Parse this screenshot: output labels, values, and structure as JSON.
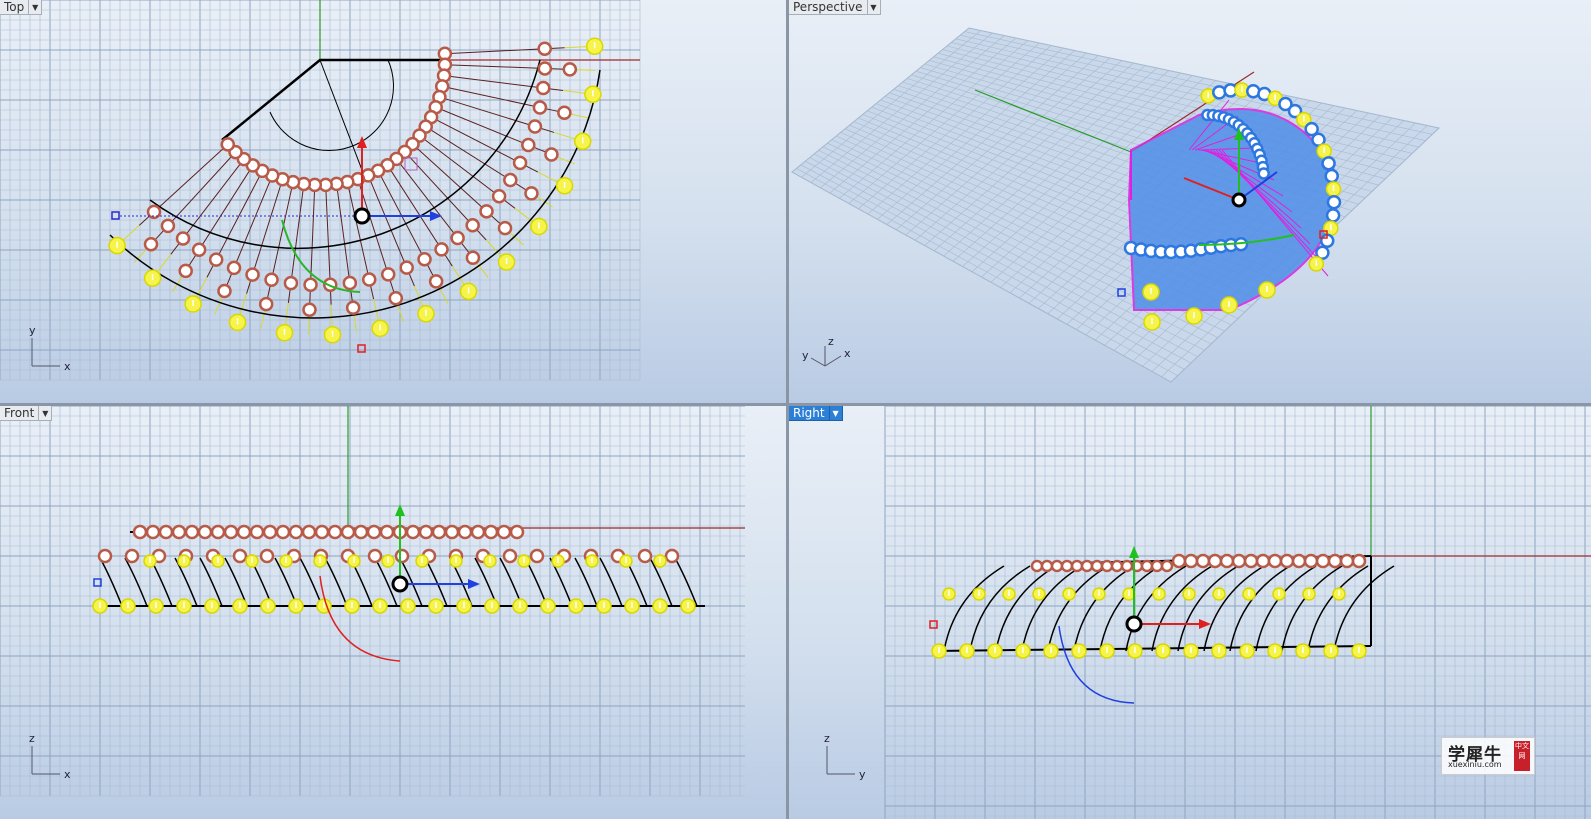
{
  "viewports": {
    "top": {
      "title": "Top",
      "axis_h": "x",
      "axis_v": "y"
    },
    "perspective": {
      "title": "Perspective",
      "axis_h": "x",
      "axis_v": "z",
      "axis_d": "y"
    },
    "front": {
      "title": "Front",
      "axis_h": "x",
      "axis_v": "z"
    },
    "right": {
      "title": "Right",
      "axis_h": "y",
      "axis_v": "z"
    }
  },
  "menu_arrow_icon": "chevron-down-icon",
  "active_viewport": "right",
  "watermark": {
    "text": "学犀牛",
    "url": "xuexiniu.com",
    "badge": "中文网"
  },
  "colors": {
    "grid": "#a9bbd0",
    "grid_major": "#8ea4bf",
    "x_axis": "#9c2a2a",
    "y_axis": "#2a9c2a",
    "control_point": "#b85a48",
    "selected_point": "#f6f44a",
    "surface": "#4f8fe8",
    "highlight": "#e020e0",
    "gumball_x": "#e02020",
    "gumball_y": "#20c020",
    "gumball_z": "#2040e0"
  }
}
